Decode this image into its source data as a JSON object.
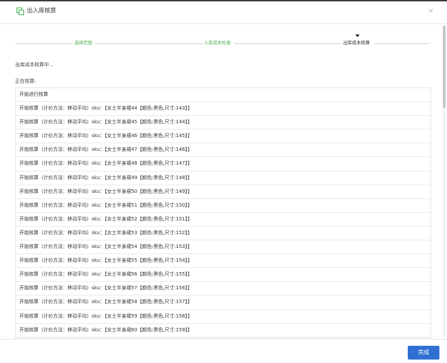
{
  "dialog": {
    "title": "出入库核算",
    "close_symbol": "×"
  },
  "steps": [
    {
      "label": "选择范围",
      "state": "done"
    },
    {
      "label": "入库成本检查",
      "state": "done"
    },
    {
      "label": "出库成本核算",
      "state": "active"
    }
  ],
  "status_text": "出库成本核算中...",
  "section_label": "正在核算:",
  "log_rows": [
    "开始进行核算",
    "开始核算（计价方法：移动平均）sku：【女士半身裙44【颜色:黑色,尺寸:143】】",
    "开始核算（计价方法：移动平均）sku：【女士半身裙45【颜色:黑色,尺寸:144】】",
    "开始核算（计价方法：移动平均）sku：【女士半身裙46【颜色:黑色,尺寸:145】】",
    "开始核算（计价方法：移动平均）sku：【女士半身裙47【颜色:黑色,尺寸:146】】",
    "开始核算（计价方法：移动平均）sku：【女士半身裙48【颜色:黑色,尺寸:147】】",
    "开始核算（计价方法：移动平均）sku：【女士半身裙49【颜色:黑色,尺寸:148】】",
    "开始核算（计价方法：移动平均）sku：【女士半身裙50【颜色:黑色,尺寸:149】】",
    "开始核算（计价方法：移动平均）sku：【女士半身裙51【颜色:黑色,尺寸:150】】",
    "开始核算（计价方法：移动平均）sku：【女士半身裙52【颜色:黑色,尺寸:151】】",
    "开始核算（计价方法：移动平均）sku：【女士半身裙53【颜色:黑色,尺寸:152】】",
    "开始核算（计价方法：移动平均）sku：【女士半身裙54【颜色:黑色,尺寸:153】】",
    "开始核算（计价方法：移动平均）sku：【女士半身裙55【颜色:黑色,尺寸:154】】",
    "开始核算（计价方法：移动平均）sku：【女士半身裙56【颜色:黑色,尺寸:155】】",
    "开始核算（计价方法：移动平均）sku：【女士半身裙57【颜色:黑色,尺寸:156】】",
    "开始核算（计价方法：移动平均）sku：【女士半身裙58【颜色:黑色,尺寸:157】】",
    "开始核算（计价方法：移动平均）sku：【女士半身裙59【颜色:黑色,尺寸:158】】",
    "开始核算（计价方法：移动平均）sku：【女士半身裙60【颜色:黑色,尺寸:159】】"
  ],
  "footer": {
    "done_label": "完成"
  },
  "colors": {
    "accent": "#2f6fd1",
    "step_done": "#4caf50",
    "title_icon": "#3bb54a"
  }
}
